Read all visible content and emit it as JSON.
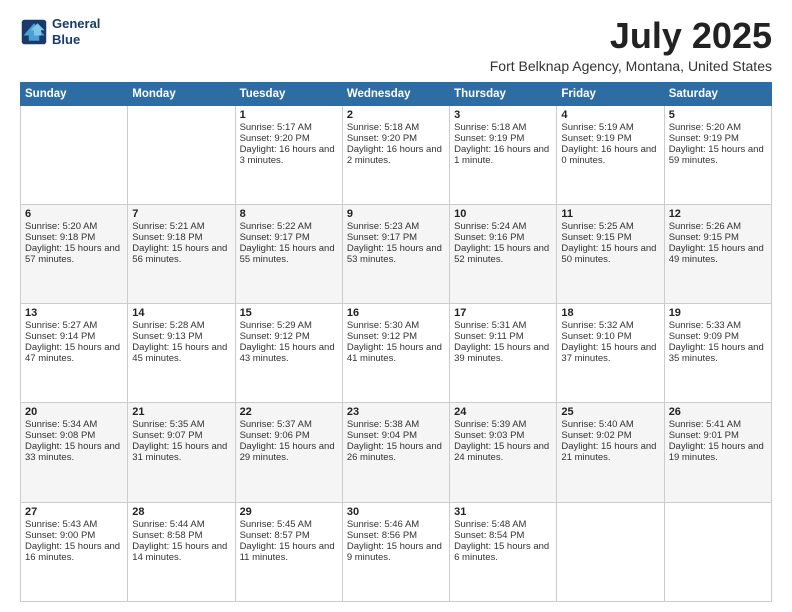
{
  "header": {
    "logo_line1": "General",
    "logo_line2": "Blue",
    "title": "July 2025",
    "subtitle": "Fort Belknap Agency, Montana, United States"
  },
  "days_of_week": [
    "Sunday",
    "Monday",
    "Tuesday",
    "Wednesday",
    "Thursday",
    "Friday",
    "Saturday"
  ],
  "weeks": [
    [
      {
        "day": "",
        "sunrise": "",
        "sunset": "",
        "daylight": ""
      },
      {
        "day": "",
        "sunrise": "",
        "sunset": "",
        "daylight": ""
      },
      {
        "day": "1",
        "sunrise": "Sunrise: 5:17 AM",
        "sunset": "Sunset: 9:20 PM",
        "daylight": "Daylight: 16 hours and 3 minutes."
      },
      {
        "day": "2",
        "sunrise": "Sunrise: 5:18 AM",
        "sunset": "Sunset: 9:20 PM",
        "daylight": "Daylight: 16 hours and 2 minutes."
      },
      {
        "day": "3",
        "sunrise": "Sunrise: 5:18 AM",
        "sunset": "Sunset: 9:19 PM",
        "daylight": "Daylight: 16 hours and 1 minute."
      },
      {
        "day": "4",
        "sunrise": "Sunrise: 5:19 AM",
        "sunset": "Sunset: 9:19 PM",
        "daylight": "Daylight: 16 hours and 0 minutes."
      },
      {
        "day": "5",
        "sunrise": "Sunrise: 5:20 AM",
        "sunset": "Sunset: 9:19 PM",
        "daylight": "Daylight: 15 hours and 59 minutes."
      }
    ],
    [
      {
        "day": "6",
        "sunrise": "Sunrise: 5:20 AM",
        "sunset": "Sunset: 9:18 PM",
        "daylight": "Daylight: 15 hours and 57 minutes."
      },
      {
        "day": "7",
        "sunrise": "Sunrise: 5:21 AM",
        "sunset": "Sunset: 9:18 PM",
        "daylight": "Daylight: 15 hours and 56 minutes."
      },
      {
        "day": "8",
        "sunrise": "Sunrise: 5:22 AM",
        "sunset": "Sunset: 9:17 PM",
        "daylight": "Daylight: 15 hours and 55 minutes."
      },
      {
        "day": "9",
        "sunrise": "Sunrise: 5:23 AM",
        "sunset": "Sunset: 9:17 PM",
        "daylight": "Daylight: 15 hours and 53 minutes."
      },
      {
        "day": "10",
        "sunrise": "Sunrise: 5:24 AM",
        "sunset": "Sunset: 9:16 PM",
        "daylight": "Daylight: 15 hours and 52 minutes."
      },
      {
        "day": "11",
        "sunrise": "Sunrise: 5:25 AM",
        "sunset": "Sunset: 9:15 PM",
        "daylight": "Daylight: 15 hours and 50 minutes."
      },
      {
        "day": "12",
        "sunrise": "Sunrise: 5:26 AM",
        "sunset": "Sunset: 9:15 PM",
        "daylight": "Daylight: 15 hours and 49 minutes."
      }
    ],
    [
      {
        "day": "13",
        "sunrise": "Sunrise: 5:27 AM",
        "sunset": "Sunset: 9:14 PM",
        "daylight": "Daylight: 15 hours and 47 minutes."
      },
      {
        "day": "14",
        "sunrise": "Sunrise: 5:28 AM",
        "sunset": "Sunset: 9:13 PM",
        "daylight": "Daylight: 15 hours and 45 minutes."
      },
      {
        "day": "15",
        "sunrise": "Sunrise: 5:29 AM",
        "sunset": "Sunset: 9:12 PM",
        "daylight": "Daylight: 15 hours and 43 minutes."
      },
      {
        "day": "16",
        "sunrise": "Sunrise: 5:30 AM",
        "sunset": "Sunset: 9:12 PM",
        "daylight": "Daylight: 15 hours and 41 minutes."
      },
      {
        "day": "17",
        "sunrise": "Sunrise: 5:31 AM",
        "sunset": "Sunset: 9:11 PM",
        "daylight": "Daylight: 15 hours and 39 minutes."
      },
      {
        "day": "18",
        "sunrise": "Sunrise: 5:32 AM",
        "sunset": "Sunset: 9:10 PM",
        "daylight": "Daylight: 15 hours and 37 minutes."
      },
      {
        "day": "19",
        "sunrise": "Sunrise: 5:33 AM",
        "sunset": "Sunset: 9:09 PM",
        "daylight": "Daylight: 15 hours and 35 minutes."
      }
    ],
    [
      {
        "day": "20",
        "sunrise": "Sunrise: 5:34 AM",
        "sunset": "Sunset: 9:08 PM",
        "daylight": "Daylight: 15 hours and 33 minutes."
      },
      {
        "day": "21",
        "sunrise": "Sunrise: 5:35 AM",
        "sunset": "Sunset: 9:07 PM",
        "daylight": "Daylight: 15 hours and 31 minutes."
      },
      {
        "day": "22",
        "sunrise": "Sunrise: 5:37 AM",
        "sunset": "Sunset: 9:06 PM",
        "daylight": "Daylight: 15 hours and 29 minutes."
      },
      {
        "day": "23",
        "sunrise": "Sunrise: 5:38 AM",
        "sunset": "Sunset: 9:04 PM",
        "daylight": "Daylight: 15 hours and 26 minutes."
      },
      {
        "day": "24",
        "sunrise": "Sunrise: 5:39 AM",
        "sunset": "Sunset: 9:03 PM",
        "daylight": "Daylight: 15 hours and 24 minutes."
      },
      {
        "day": "25",
        "sunrise": "Sunrise: 5:40 AM",
        "sunset": "Sunset: 9:02 PM",
        "daylight": "Daylight: 15 hours and 21 minutes."
      },
      {
        "day": "26",
        "sunrise": "Sunrise: 5:41 AM",
        "sunset": "Sunset: 9:01 PM",
        "daylight": "Daylight: 15 hours and 19 minutes."
      }
    ],
    [
      {
        "day": "27",
        "sunrise": "Sunrise: 5:43 AM",
        "sunset": "Sunset: 9:00 PM",
        "daylight": "Daylight: 15 hours and 16 minutes."
      },
      {
        "day": "28",
        "sunrise": "Sunrise: 5:44 AM",
        "sunset": "Sunset: 8:58 PM",
        "daylight": "Daylight: 15 hours and 14 minutes."
      },
      {
        "day": "29",
        "sunrise": "Sunrise: 5:45 AM",
        "sunset": "Sunset: 8:57 PM",
        "daylight": "Daylight: 15 hours and 11 minutes."
      },
      {
        "day": "30",
        "sunrise": "Sunrise: 5:46 AM",
        "sunset": "Sunset: 8:56 PM",
        "daylight": "Daylight: 15 hours and 9 minutes."
      },
      {
        "day": "31",
        "sunrise": "Sunrise: 5:48 AM",
        "sunset": "Sunset: 8:54 PM",
        "daylight": "Daylight: 15 hours and 6 minutes."
      },
      {
        "day": "",
        "sunrise": "",
        "sunset": "",
        "daylight": ""
      },
      {
        "day": "",
        "sunrise": "",
        "sunset": "",
        "daylight": ""
      }
    ]
  ]
}
